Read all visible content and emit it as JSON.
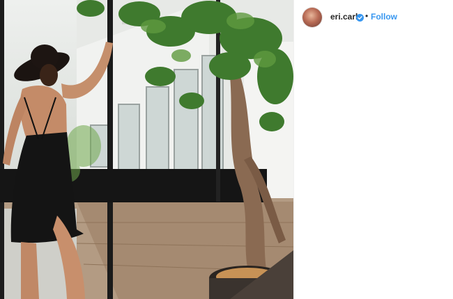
{
  "post": {
    "header": {
      "username": "eri.carl",
      "separator": "•",
      "follow_label": "Follow"
    },
    "colors": {
      "follow": "#3897f0",
      "verified_badge": "#3897f0",
      "username": "#262626"
    },
    "icons": {
      "verified": "verified-badge-icon"
    }
  }
}
